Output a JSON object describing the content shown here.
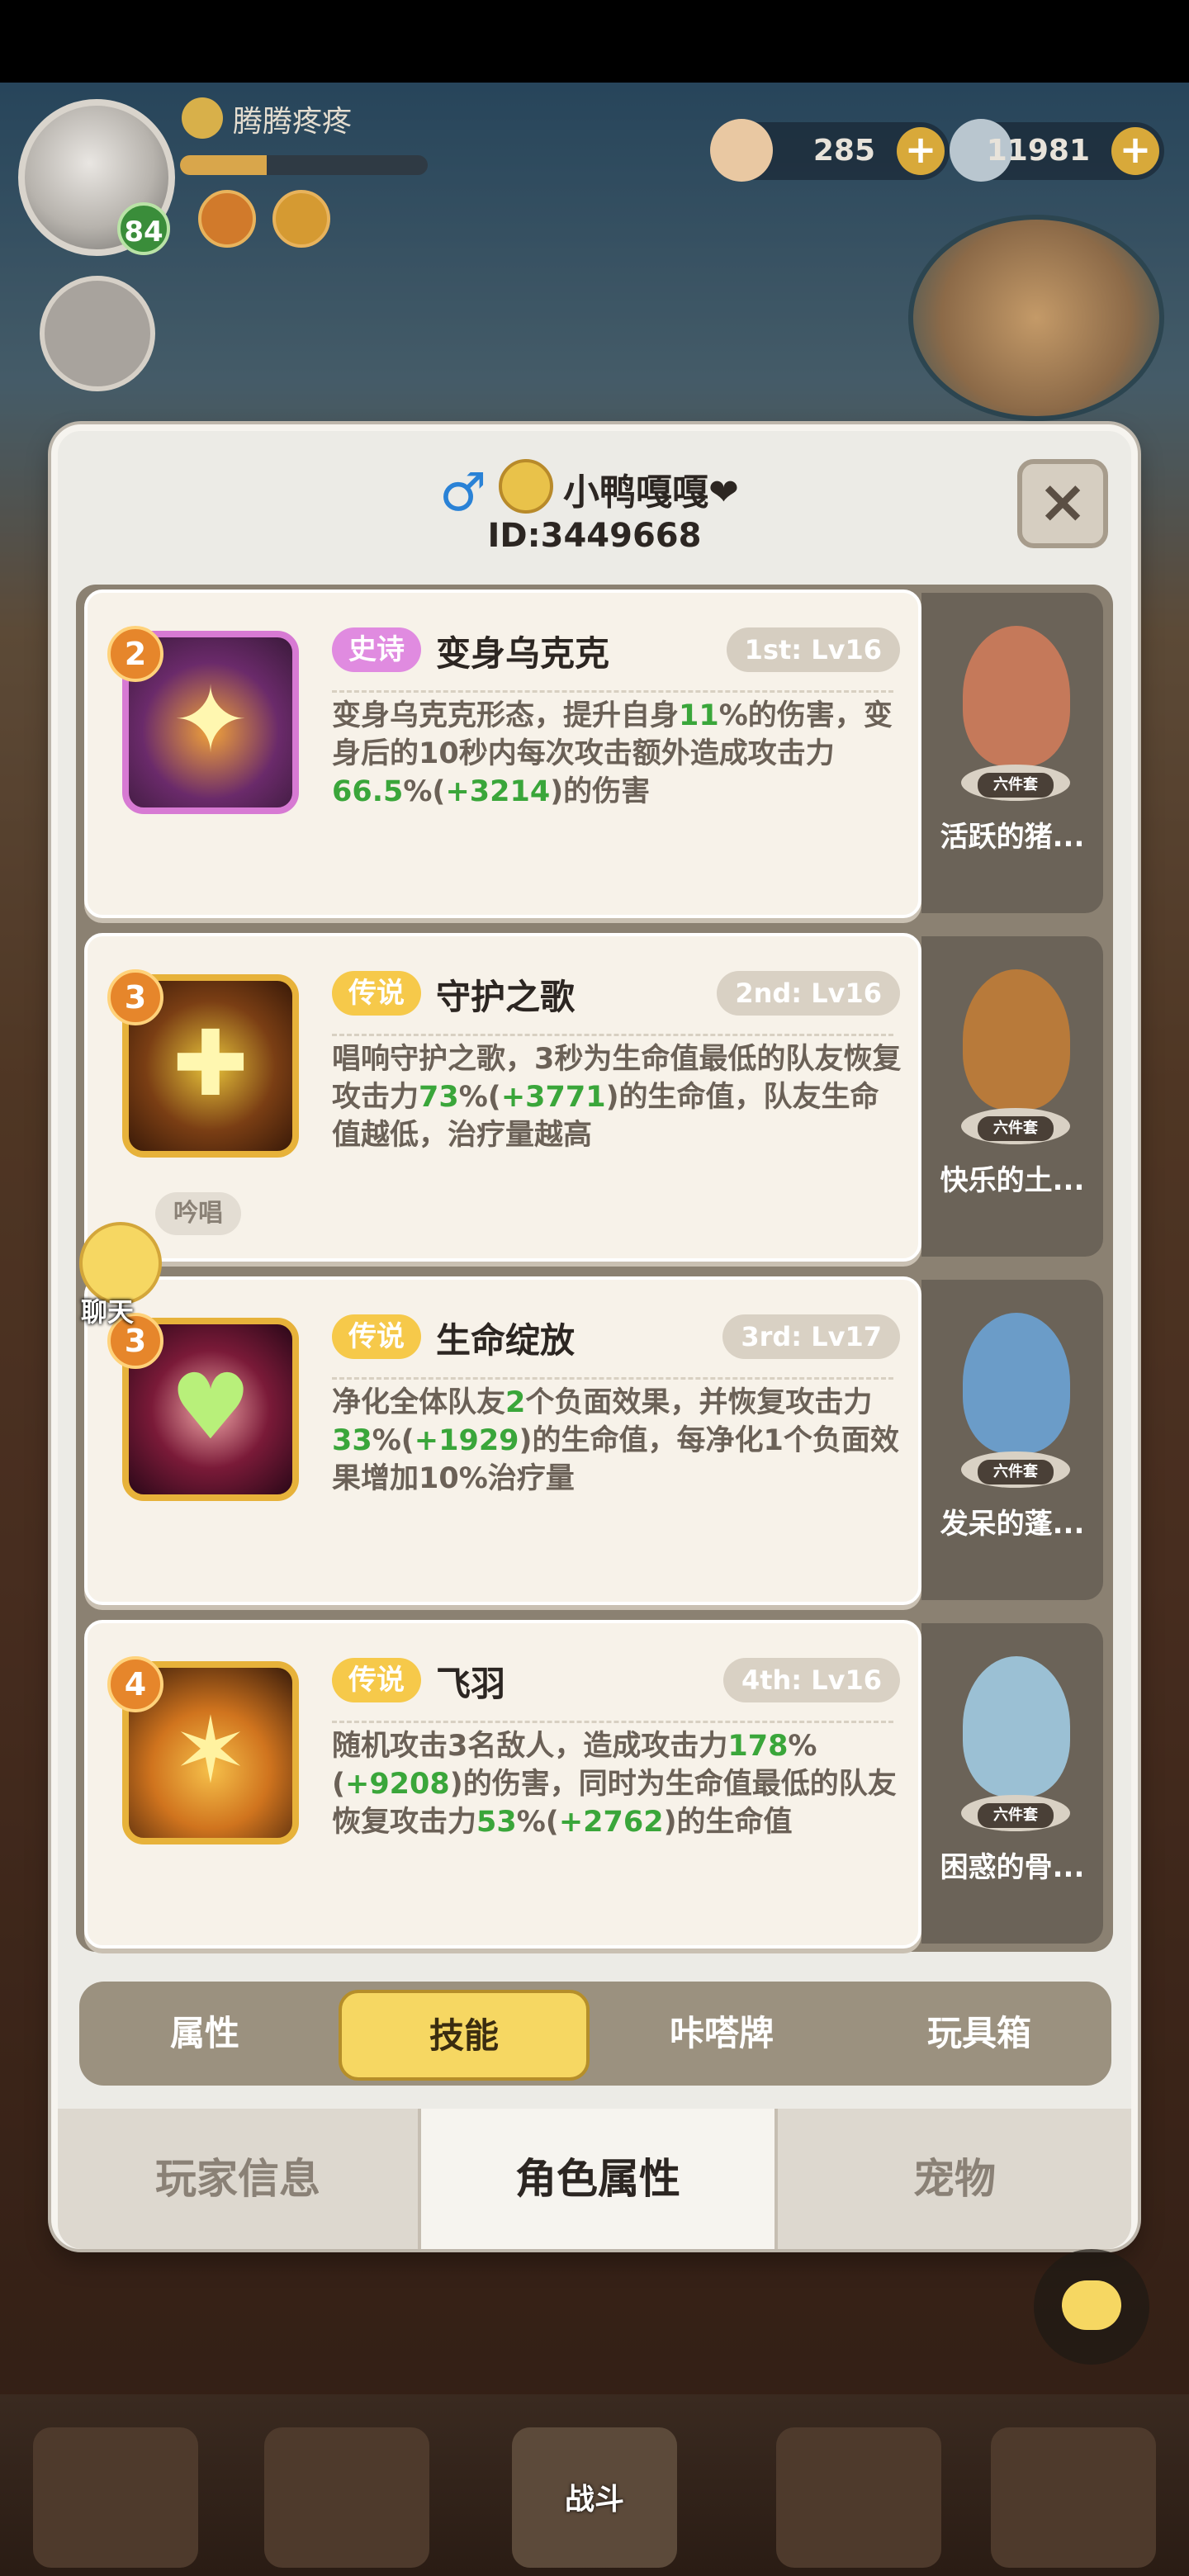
{
  "hud": {
    "player_name": "腾腾疼疼",
    "level": "84",
    "exp_fraction": 0.35,
    "currency_shell": "285",
    "currency_gem": "11981",
    "plus_label": "+"
  },
  "modal": {
    "gender_symbol": "♂",
    "player_name": "小鸭嘎嘎❤",
    "player_id": "ID:3449668",
    "close_label": "×"
  },
  "skills": [
    {
      "rank": "2",
      "rarity": "史诗",
      "name": "变身乌克克",
      "slot": "1st: Lv16",
      "desc_parts": [
        "变身乌克克形态，提升自身",
        "11",
        "%的伤害，变身后的10秒内每次攻击额外造成攻击力",
        "66.5",
        "%(",
        "+3214",
        ")的伤害"
      ],
      "extra_tag": "",
      "pet_name": "活跃的猪...",
      "pet_set": "六件套"
    },
    {
      "rank": "3",
      "rarity": "传说",
      "name": "守护之歌",
      "slot": "2nd: Lv16",
      "desc_parts": [
        "唱响守护之歌，3秒为生命值最低的队友恢复攻击力",
        "73",
        "%(",
        "+3771",
        ")的生命值，队友生命值越低，治疗量越高",
        "",
        "",
        ""
      ],
      "extra_tag": "吟唱",
      "pet_name": "快乐的土...",
      "pet_set": "六件套"
    },
    {
      "rank": "3",
      "rarity": "传说",
      "name": "生命绽放",
      "slot": "3rd: Lv17",
      "desc_parts": [
        "净化全体队友",
        "2",
        "个负面效果，并恢复攻击力",
        "33",
        "%(",
        "+1929",
        ")的生命值，每净化1个负面效果增加10%治疗量"
      ],
      "extra_tag": "",
      "pet_name": "发呆的蓬...",
      "pet_set": "六件套"
    },
    {
      "rank": "4",
      "rarity": "传说",
      "name": "飞羽",
      "slot": "4th: Lv16",
      "desc_parts": [
        "随机攻击3名敌人，造成攻击力",
        "178",
        "%(",
        "+9208",
        ")的伤害，同时为生命值最低的队友恢复攻击力",
        "53",
        "%(",
        "+2762",
        ")的生命值"
      ],
      "extra_tag": "",
      "pet_name": "困惑的骨...",
      "pet_set": "六件套"
    }
  ],
  "sub_tabs": [
    "属性",
    "技能",
    "咔嗒牌",
    "玩具箱"
  ],
  "bottom_tabs": [
    "玩家信息",
    "角色属性",
    "宠物"
  ],
  "chat_label": "聊天",
  "nav_center_label": "战斗"
}
